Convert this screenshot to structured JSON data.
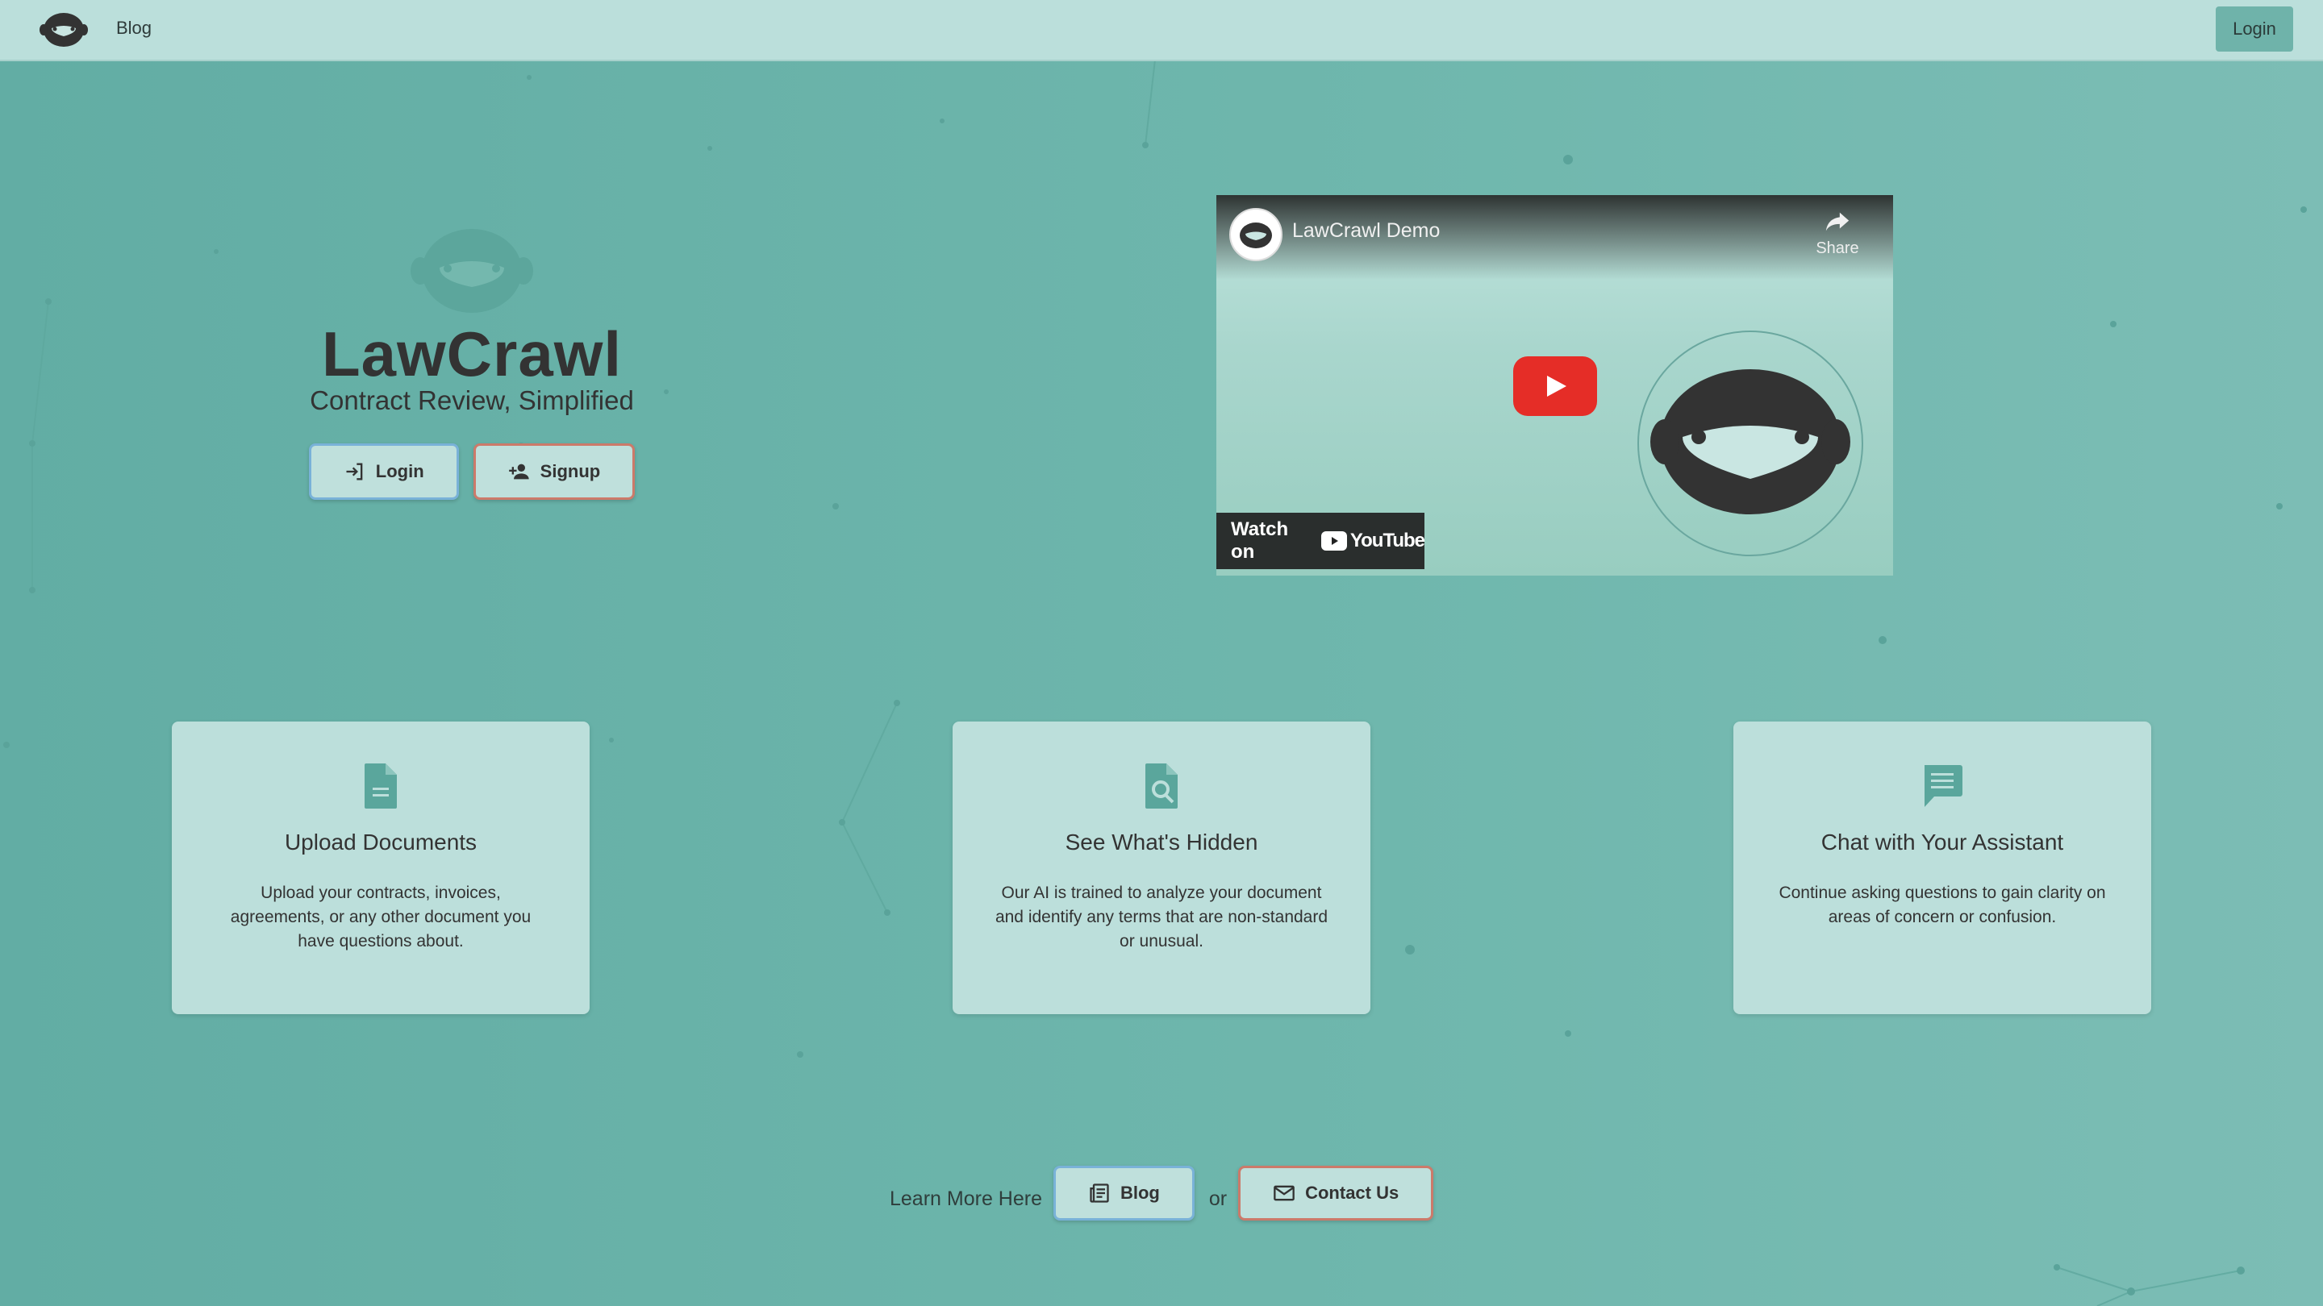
{
  "nav": {
    "blog_label": "Blog",
    "login_label": "Login"
  },
  "hero": {
    "title": "LawCrawl",
    "subtitle": "Contract Review, Simplified",
    "login_label": "Login",
    "signup_label": "Signup"
  },
  "video": {
    "title": "LawCrawl Demo",
    "share_label": "Share",
    "watch_on_label": "Watch on",
    "youtube_wordmark": "YouTube"
  },
  "features": [
    {
      "icon": "document-icon",
      "title": "Upload Documents",
      "description": "Upload your contracts, invoices, agreements, or any other document you have questions about."
    },
    {
      "icon": "document-search-icon",
      "title": "See What's Hidden",
      "description": "Our AI is trained to analyze your document and identify any terms that are non-standard or unusual."
    },
    {
      "icon": "chat-icon",
      "title": "Chat with Your Assistant",
      "description": "Continue asking questions to gain clarity on areas of concern or confusion."
    }
  ],
  "cta": {
    "text": "Learn More Here",
    "blog_label": "Blog",
    "or_label": "or",
    "contact_label": "Contact Us"
  },
  "colors": {
    "background": "#6fb7ad",
    "nav": "#bbdfdb",
    "card": "#bcdfdb",
    "accent_teal": "#5aa69c",
    "button_border_blue": "#79b2d8",
    "button_border_red": "#cc7a6a",
    "youtube_red": "#e52d27"
  }
}
